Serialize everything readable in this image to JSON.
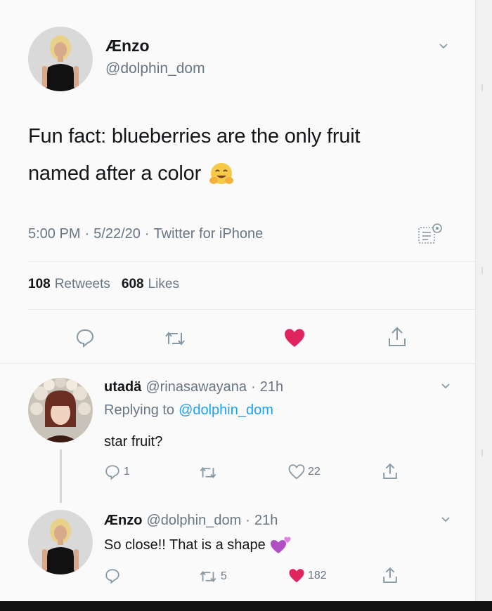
{
  "main_tweet": {
    "author_name": "Ænzo",
    "author_handle": "@dolphin_dom",
    "text_line1": "Fun fact: blueberries are the only fruit",
    "text_line2": "named after a color",
    "emoji": "hugging-face-emoji",
    "time": "5:00 PM",
    "sep1": "·",
    "date": "5/22/20",
    "sep2": "·",
    "source": "Twitter for iPhone",
    "retweets_count": "108",
    "retweets_label": "Retweets",
    "likes_count": "608",
    "likes_label": "Likes"
  },
  "reply1": {
    "author_name": "utadä",
    "author_handle": "@rinasawayana",
    "sep": "·",
    "age": "21h",
    "replying_prefix": "Replying to",
    "replying_handle": "@dolphin_dom",
    "text": "star fruit?",
    "reply_count": "1",
    "like_count": "22"
  },
  "reply2": {
    "author_name": "Ænzo",
    "author_handle": "@dolphin_dom",
    "sep": "·",
    "age": "21h",
    "text": "So close!! That is a shape",
    "emoji": "purple-hearts-emoji",
    "retweet_count": "5",
    "like_count": "182"
  },
  "colors": {
    "link_blue": "#1da1f2",
    "like_red": "#e0245e",
    "muted_gray": "#687684"
  }
}
